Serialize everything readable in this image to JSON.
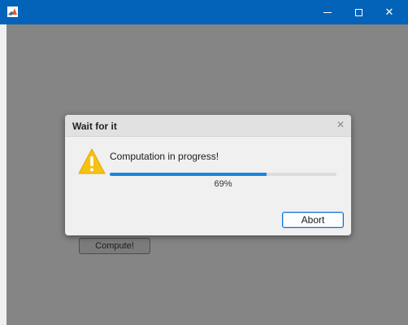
{
  "window": {
    "titlebar_color": "#0263b8",
    "controls": {
      "minimize_icon": "minimize-icon",
      "maximize_icon": "maximize-icon",
      "close_icon": "close-icon",
      "close_glyph": "✕"
    }
  },
  "main": {
    "compute_label": "Compute!"
  },
  "dialog": {
    "title": "Wait for it",
    "close_glyph": "✕",
    "icon": "warning-icon",
    "message": "Computation in progress!",
    "progress": 0.69,
    "progress_label": "69%",
    "progress_color": "#1a86e0",
    "abort_label": "Abort"
  }
}
